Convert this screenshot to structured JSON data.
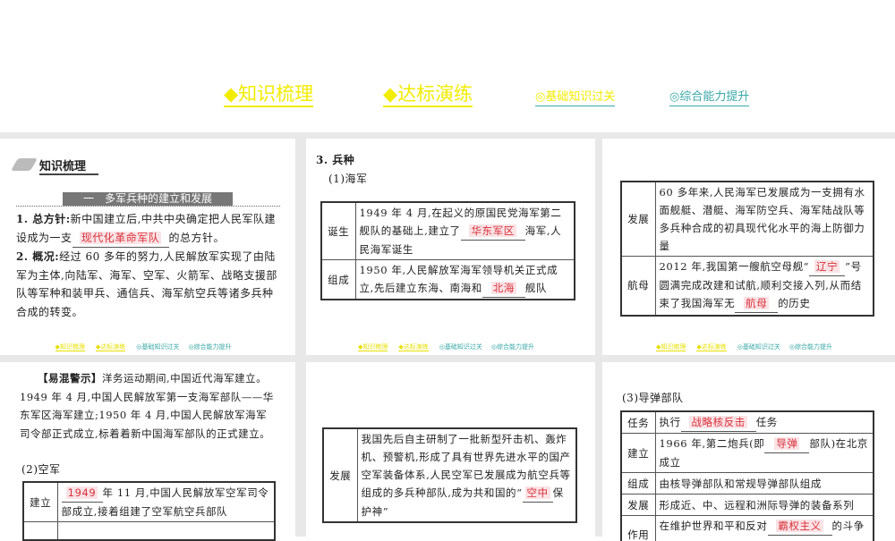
{
  "nav": {
    "items": [
      "◆知识梳理",
      "◆达标演练",
      "◎基础知识过关",
      "◎综合能力提升"
    ]
  },
  "slide1": {
    "heading": "知识梳理",
    "section_bar": "一　多军兵种的建立和发展",
    "p1_label": "1. 总方针:",
    "p1_a": "新中国建立后,中共中央确定把人民军队建设成为一支",
    "p1_blank": "现代化革命军队",
    "p1_b": "的总方针。",
    "p2_label": "2. 概况:",
    "p2_text": "经过 60 多年的努力,人民解放军实现了由陆军为主体,向陆军、海军、空军、火箭军、战略支援部队等军种和装甲兵、通信兵、海军航空兵等诸多兵种合成的转变。"
  },
  "slide2": {
    "heading": "3. 兵种",
    "sub": "(1)海军",
    "rows": [
      {
        "label": "诞生",
        "a": "1949 年 4 月,在起义的原国民党海军第二舰队的基础上,建立了",
        "blank": "华东军区",
        "b": "海军,人民海军诞生"
      },
      {
        "label": "组成",
        "a": "1950 年,人民解放军海军领导机关正式成立,先后建立东海、南海和",
        "blank": "北海",
        "b": "舰队"
      }
    ]
  },
  "slide3": {
    "rows": [
      {
        "label": "发展",
        "a": "60 多年来,人民海军已发展成为一支拥有水面舰艇、潜艇、海军防空兵、海军陆战队等多兵种合成的初具现代化水平的海上防御力量"
      },
      {
        "label": "航母",
        "a": "2012 年,我国第一艘航空母舰“",
        "blank": "辽宁",
        "b": "”号圆满完成改建和试航,顺利交接入列,从而结束了我国海军无",
        "blank2": "航母",
        "c": "的历史"
      }
    ]
  },
  "slide4": {
    "warn_label": "【易混警示】",
    "warn_text": "洋务运动期间,中国近代海军建立。1949 年 4 月,中国人民解放军第一支海军部队——华东军区海军建立;1950 年 4 月,中国人民解放军海军司令部正式成立,标着着新中国海军部队的正式建立。",
    "sub": "(2)空军",
    "row": {
      "label": "建立",
      "blank": "1949",
      "b": "年 11 月,中国人民解放军空军司令部成立,接着组建了空军航空兵部队"
    }
  },
  "slide5": {
    "row": {
      "label": "发展",
      "a": "我国先后自主研制了一批新型歼击机、轰炸机、预警机,形成了具有世界先进水平的国产空军装备体系,人民空军已发展成为航空兵等组成的多兵种部队,成为共和国的“",
      "blank": "空中",
      "b": "保护神”"
    }
  },
  "slide6": {
    "sub": "(3)导弹部队",
    "rows": [
      {
        "label": "任务",
        "a": "执行",
        "blank": "战略核反击",
        "b": "任务"
      },
      {
        "label": "建立",
        "a": "1966 年,第二炮兵(即",
        "blank": "导弹",
        "b": "部队)在北京成立"
      },
      {
        "label": "组成",
        "a": "由核导弹部队和常规导弹部队组成"
      },
      {
        "label": "发展",
        "a": "形成近、中、远程和洲际导弹的装备系列"
      },
      {
        "label": "作用",
        "a": "在维护世界和平和反对",
        "blank": "霸权主义",
        "b": "的斗争"
      }
    ]
  }
}
